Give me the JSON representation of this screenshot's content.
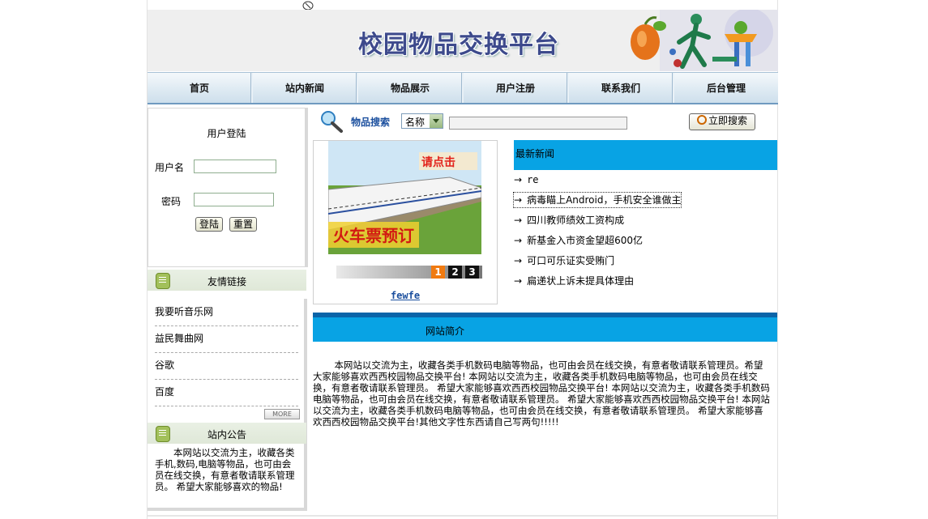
{
  "banner": {
    "title": "校园物品交换平台"
  },
  "nav": [
    "首页",
    "站内新闻",
    "物品展示",
    "用户注册",
    "联系我们",
    "后台管理"
  ],
  "login": {
    "title": "用户登陆",
    "username_label": "用户名",
    "password_label": "密码",
    "login_button": "登陆",
    "reset_button": "重置"
  },
  "friend_links": {
    "title": "友情链接",
    "items": [
      "我要听音乐网",
      "益民舞曲网",
      "谷歌",
      "百度"
    ],
    "more_label": "MORE"
  },
  "notice": {
    "title": "站内公告",
    "text": "本网站以交流为主，收藏各类手机,数码,电脑等物品，也可由会员在线交换，有意者敬请联系管理员。    希望大家能够喜欢的物品!"
  },
  "search": {
    "label": "物品搜索",
    "field_selected": "名称",
    "button": "立即搜索"
  },
  "slideshow": {
    "image_text": "火车票预订",
    "image_badge": "请点击",
    "pages": [
      "1",
      "2",
      "3"
    ],
    "active_page": 1,
    "caption": "fewfe"
  },
  "news": {
    "title": "最新新闻",
    "items": [
      "re",
      "病毒瞄上Android，手机安全谁做主",
      "四川教师绩效工资构成",
      "新基金入市资金望超600亿",
      "可口可乐证实受贿门",
      "扁递状上诉未提具体理由"
    ]
  },
  "intro": {
    "title": "网站简介",
    "text": "本网站以交流为主，收藏各类手机数码电脑等物品，也可由会员在线交换，有意者敬请联系管理员。希望大家能够喜欢西西校园物品交换平台!        本网站以交流为主，收藏各类手机数码电脑等物品，也可由会员在线交换，有意者敬请联系管理员。    希望大家能够喜欢西西校园物品交换平台!        本网站以交流为主，收藏各类手机数码电脑等物品，也可由会员在线交换，有意者敬请联系管理员。    希望大家能够喜欢西西校园物品交换平台!        本网站以交流为主，收藏各类手机数码电脑等物品，也可由会员在线交换，有意者敬请联系管理员。    希望大家能够喜欢西西校园物品交换平台!其他文字性东西请自己写两句!!!!!"
  },
  "colors": {
    "accent_blue": "#08a3e4",
    "dark_blue": "#0b64a8",
    "link_blue": "#1b4f9e"
  }
}
